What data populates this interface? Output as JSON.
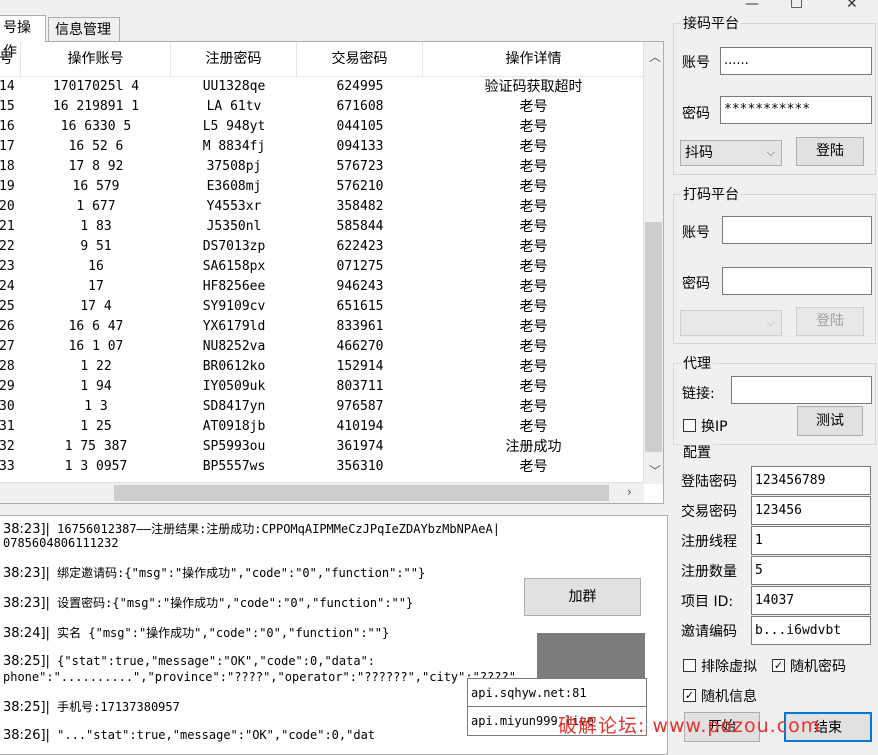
{
  "window": {
    "minimize": "—",
    "maximize": "□",
    "close": "✕"
  },
  "tabs": [
    {
      "label": "号操作",
      "active": true
    },
    {
      "label": "信息管理",
      "active": false
    }
  ],
  "grid": {
    "columns": [
      "号",
      "操作账号",
      "注册密码",
      "交易密码",
      "操作详情"
    ],
    "rows": [
      [
        "14",
        "17017025l 4",
        "UU1328qe",
        "624995",
        "验证码获取超时"
      ],
      [
        "15",
        "16 219891 1",
        "LA 61tv",
        "671608",
        "老号"
      ],
      [
        "16",
        "16  6330 5",
        "L5 948yt",
        "044105",
        "老号"
      ],
      [
        "17",
        "16  52  6",
        "M 8834fj",
        "094133",
        "老号"
      ],
      [
        "18",
        "17  8  92",
        "37508pj",
        "576723",
        "老号"
      ],
      [
        "19",
        "16   579",
        "E3608mj",
        "576210",
        "老号"
      ],
      [
        "20",
        "1   677",
        "Y4553xr",
        "358482",
        "老号"
      ],
      [
        "21",
        "1    83",
        "J5350nl",
        "585844",
        "老号"
      ],
      [
        "22",
        "  9 51",
        "DS7013zp",
        "622423",
        "老号"
      ],
      [
        "23",
        "16",
        "SA6158px",
        "071275",
        "老号"
      ],
      [
        "24",
        "17",
        "HF8256ee",
        "946243",
        "老号"
      ],
      [
        "25",
        "17     4",
        "SY9109cv",
        "651615",
        "老号"
      ],
      [
        "26",
        "16 6   47",
        "YX6179ld",
        "833961",
        "老号"
      ],
      [
        "27",
        "16 1   07",
        "NU8252va",
        "466270",
        "老号"
      ],
      [
        "28",
        "1    22",
        "BR0612ko",
        "152914",
        "老号"
      ],
      [
        "29",
        "1    94",
        "IY0509uk",
        "803711",
        "老号"
      ],
      [
        "30",
        "1  3",
        "SD8417yn",
        "976587",
        "老号"
      ],
      [
        "31",
        "1  25",
        "AT0918jb",
        "410194",
        "老号"
      ],
      [
        "32",
        "1 75  387",
        "SP5993ou",
        "361974",
        "注册成功"
      ],
      [
        "33",
        "1  3 0957",
        "BP5557ws",
        "356310",
        "老号"
      ]
    ]
  },
  "log": {
    "lines": [
      {
        "time": "38:23]|",
        "text": " 16756012387——注册结果:注册成功:CPPOMqAIPMMeCzJPqIeZDAYbzMbNPAeA|"
      },
      {
        "time": "",
        "text": "0785604806111232"
      },
      {
        "time": "38:23]|",
        "text": " 绑定邀请码:{\"msg\":\"操作成功\",\"code\":\"0\",\"function\":\"\"}"
      },
      {
        "time": "38:23]|",
        "text": " 设置密码:{\"msg\":\"操作成功\",\"code\":\"0\",\"function\":\"\"}"
      },
      {
        "time": "38:24]|",
        "text": " 实名 {\"msg\":\"操作成功\",\"code\":\"0\",\"function\":\"\"}"
      },
      {
        "time": "38:25]|",
        "text": " {\"stat\":true,\"message\":\"OK\",\"code\":0,\"data\":"
      },
      {
        "time": "",
        "text": "phone\":\"..........\",\"province\":\"????\",\"operator\":\"??????\",\"city\":\"????\""
      },
      {
        "time": "38:25]|",
        "text": " 手机号:17137380957"
      },
      {
        "time": "38:26]|",
        "text": " \"...\"stat\":true,\"message\":\"OK\",\"code\":0,\"dat"
      }
    ],
    "join_group_button": "加群",
    "api1": "api.sqhyw.net:81",
    "api2": "api.miyun999.live"
  },
  "jiema": {
    "title": "接码平台",
    "account_label": "账号",
    "account_value": "......",
    "password_label": "密码",
    "password_value": "***********",
    "platform": "抖码",
    "login_button": "登陆"
  },
  "dama": {
    "title": "打码平台",
    "account_label": "账号",
    "account_value": "",
    "password_label": "密码",
    "password_value": "",
    "platform": "",
    "login_button": "登陆"
  },
  "proxy": {
    "title": "代理",
    "link_label": "链接:",
    "link_value": "",
    "change_ip_label": "换IP",
    "change_ip_checked": false,
    "test_button": "测试"
  },
  "config": {
    "title": "配置",
    "fields": [
      {
        "label": "登陆密码",
        "value": "123456789"
      },
      {
        "label": "交易密码",
        "value": "123456"
      },
      {
        "label": "注册线程",
        "value": "1"
      },
      {
        "label": "注册数量",
        "value": "5"
      },
      {
        "label": "项目 ID:",
        "value": "14037"
      },
      {
        "label": "邀请编码",
        "value": "b...i6wdvbt"
      }
    ],
    "exclude_virtual": {
      "label": "排除虚拟",
      "checked": false
    },
    "random_password": {
      "label": "随机密码",
      "checked": true
    },
    "random_info": {
      "label": "随机信息",
      "checked": true
    },
    "start_button": "开始",
    "end_button": "结束"
  },
  "watermark": "破解论坛: www.pozou.com"
}
